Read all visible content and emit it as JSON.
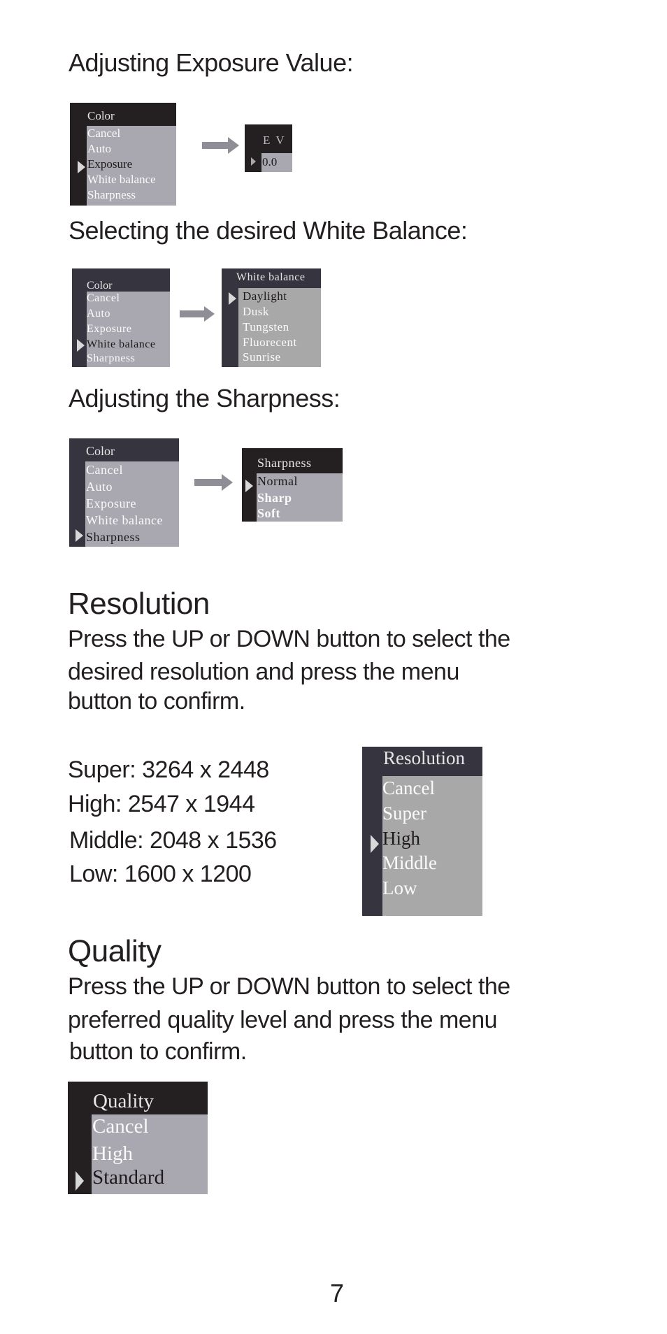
{
  "sections": {
    "exposure": {
      "heading": "Adjusting Exposure Value:",
      "main_menu": {
        "title": "Color",
        "items": [
          "Cancel",
          "Auto",
          "Exposure",
          "White balance",
          "Sharpness"
        ],
        "selected": "Exposure"
      },
      "sub_menu": {
        "title": "E V",
        "items": [
          "0.0"
        ],
        "selected": "0.0"
      }
    },
    "white_balance": {
      "heading": "Selecting the desired White Balance:",
      "main_menu": {
        "title": "Color",
        "items": [
          "Cancel",
          "Auto",
          "Exposure",
          "White balance",
          "Sharpness"
        ],
        "selected": "White balance"
      },
      "sub_menu": {
        "title": "White balance",
        "items": [
          "Daylight",
          "Dusk",
          "Tungsten",
          "Fluorecent",
          "Sunrise"
        ],
        "selected": "Daylight"
      }
    },
    "sharpness": {
      "heading": "Adjusting the Sharpness:",
      "main_menu": {
        "title": "Color",
        "items": [
          "Cancel",
          "Auto",
          "Exposure",
          "White balance",
          "Sharpness"
        ],
        "selected": "Sharpness"
      },
      "sub_menu": {
        "title": "Sharpness",
        "items": [
          "Normal",
          "Sharp",
          "Soft"
        ],
        "selected": "Normal"
      }
    },
    "resolution": {
      "heading": "Resolution",
      "paragraph_lines": [
        "Press the UP or DOWN button to select the",
        "desired resolution and press the menu",
        "button to confirm."
      ],
      "options": [
        "Super: 3264 x 2448",
        "High: 2547 x 1944",
        "Middle: 2048 x 1536",
        "Low: 1600 x 1200"
      ],
      "menu": {
        "title": "Resolution",
        "items": [
          "Cancel",
          "Super",
          "High",
          "Middle",
          "Low"
        ],
        "selected": "High"
      }
    },
    "quality": {
      "heading": "Quality",
      "paragraph_lines": [
        "Press the UP or DOWN button to select the",
        "preferred quality level and press the menu",
        "button to confirm."
      ],
      "menu": {
        "title": "Quality",
        "items": [
          "Cancel",
          "High",
          "Standard"
        ],
        "selected": "Standard"
      }
    }
  },
  "page_number": "7",
  "colors": {
    "menu_dark": "#242021",
    "menu_dark_blue": "#36353f",
    "menu_body": "#a9a8b0",
    "arrow": "#8f8e96"
  }
}
